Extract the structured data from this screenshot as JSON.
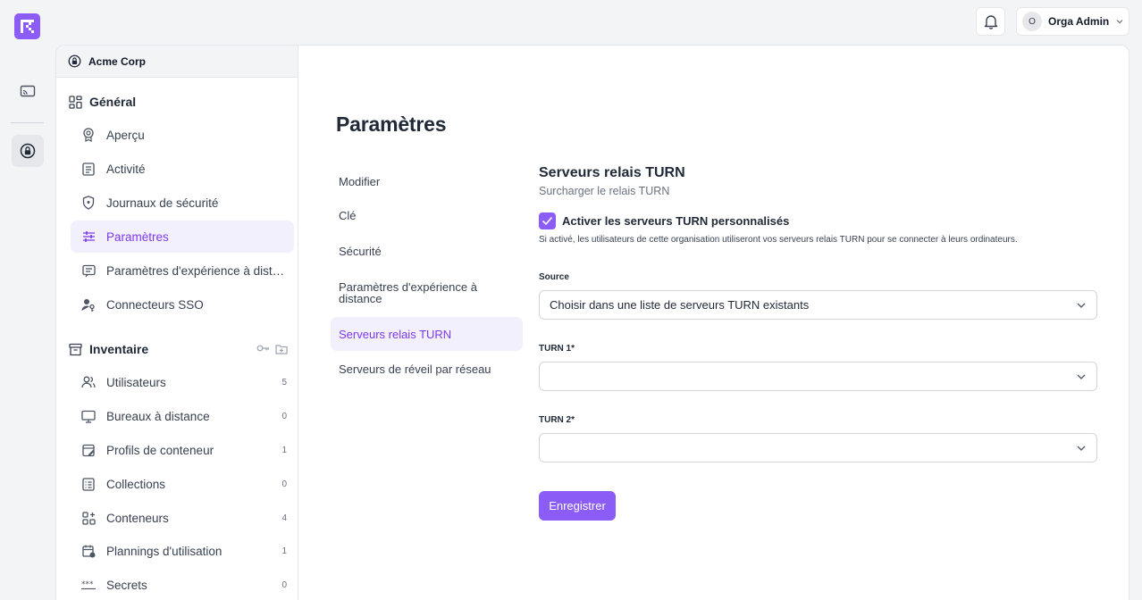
{
  "topbar": {
    "user_initial": "O",
    "user_name": "Orga Admin"
  },
  "org": {
    "name": "Acme Corp"
  },
  "sidebar": {
    "general": {
      "title": "Général",
      "items": [
        {
          "label": "Aperçu"
        },
        {
          "label": "Activité"
        },
        {
          "label": "Journaux de sécurité"
        },
        {
          "label": "Paramètres"
        },
        {
          "label": "Paramètres d'expérience à distance"
        },
        {
          "label": "Connecteurs SSO"
        }
      ]
    },
    "inventory": {
      "title": "Inventaire",
      "items": [
        {
          "label": "Utilisateurs",
          "count": "5"
        },
        {
          "label": "Bureaux à distance",
          "count": "0"
        },
        {
          "label": "Profils de conteneur",
          "count": "1"
        },
        {
          "label": "Collections",
          "count": "0"
        },
        {
          "label": "Conteneurs",
          "count": "4"
        },
        {
          "label": "Plannings d'utilisation",
          "count": "1"
        },
        {
          "label": "Secrets",
          "count": "0"
        }
      ]
    }
  },
  "main": {
    "title": "Paramètres",
    "subnav": [
      {
        "label": "Modifier"
      },
      {
        "label": "Clé"
      },
      {
        "label": "Sécurité"
      },
      {
        "label": "Paramètres d'expérience à distance"
      },
      {
        "label": "Serveurs relais TURN"
      },
      {
        "label": "Serveurs de réveil par réseau"
      }
    ],
    "form": {
      "title": "Serveurs relais TURN",
      "subtitle": "Surcharger le relais TURN",
      "checkbox_label": "Activer les serveurs TURN personnalisés",
      "checkbox_help": "Si activé, les utilisateurs de cette organisation utiliseront vos serveurs relais TURN pour se connecter à leurs ordinateurs.",
      "source_label": "Source",
      "source_value": "Choisir dans une liste de serveurs TURN existants",
      "turn1_label": "TURN 1*",
      "turn1_value": "",
      "turn2_label": "TURN 2*",
      "turn2_value": "",
      "save_label": "Enregistrer"
    }
  },
  "colors": {
    "accent": "#8b5cf6",
    "accent_text": "#7c3aed",
    "accent_bg": "#f3f0fd"
  }
}
